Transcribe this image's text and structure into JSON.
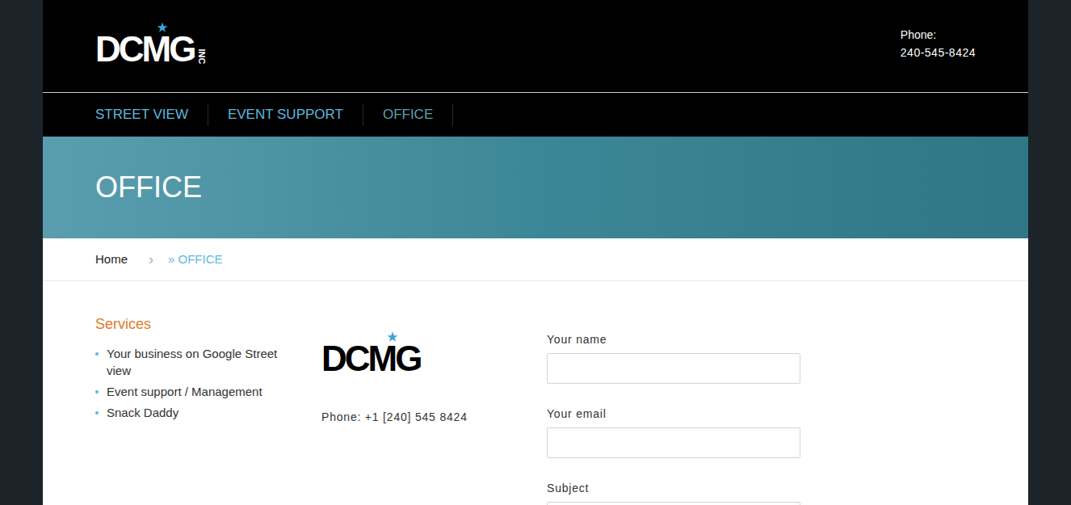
{
  "header": {
    "logo": {
      "text": "DCMG",
      "suffix": "INC"
    },
    "phone_label": "Phone:",
    "phone": "240-545-8424"
  },
  "nav": [
    {
      "label": "STREET VIEW",
      "selected": false
    },
    {
      "label": "EVENT SUPPORT",
      "selected": false
    },
    {
      "label": "OFFICE",
      "selected": true
    }
  ],
  "banner": {
    "title": "OFFICE"
  },
  "breadcrumb": {
    "home": "Home",
    "separator": "›",
    "current": "» OFFICE"
  },
  "sidebar": {
    "title": "Services",
    "items": [
      "Your business on Google Street view",
      "Event support / Management",
      "Snack Daddy"
    ]
  },
  "contact": {
    "logo": "DCMG",
    "phone": "Phone: +1 [240] 545 8424"
  },
  "form": {
    "fields": [
      {
        "label": "Your name",
        "value": ""
      },
      {
        "label": "Your email",
        "value": ""
      },
      {
        "label": "Subject",
        "value": ""
      }
    ]
  }
}
